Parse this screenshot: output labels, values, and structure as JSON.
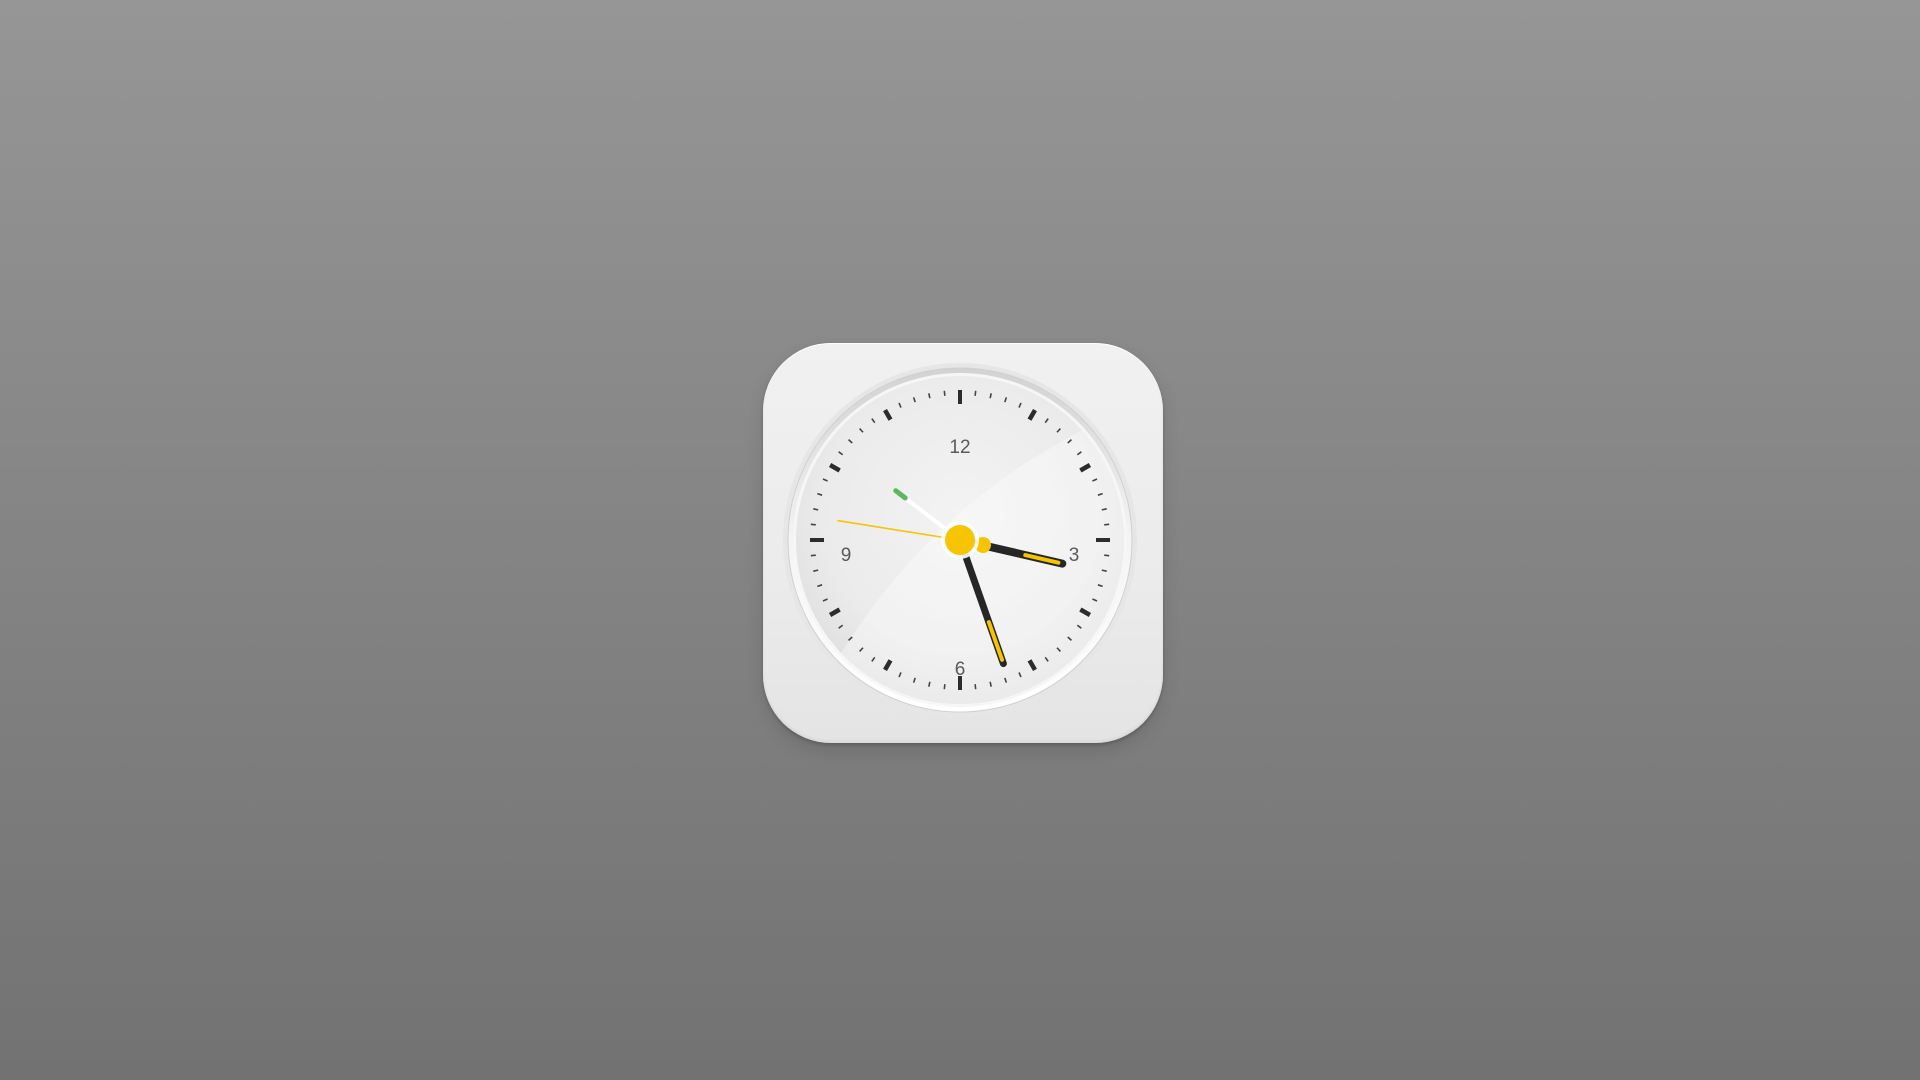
{
  "clock": {
    "numerals": {
      "twelve": "12",
      "three": "3",
      "six": "6",
      "nine": "9"
    },
    "time": {
      "hour": 3,
      "minute": 26,
      "second": 46.5,
      "alarm_hour": 10,
      "alarm_minute": 15
    },
    "colors": {
      "accent": "#f6c400",
      "hands": "#262626",
      "alarm_tip": "#5cb85c",
      "ticks": "#333333",
      "face": "#ececec"
    },
    "icons": {
      "app": "clock-icon"
    }
  }
}
